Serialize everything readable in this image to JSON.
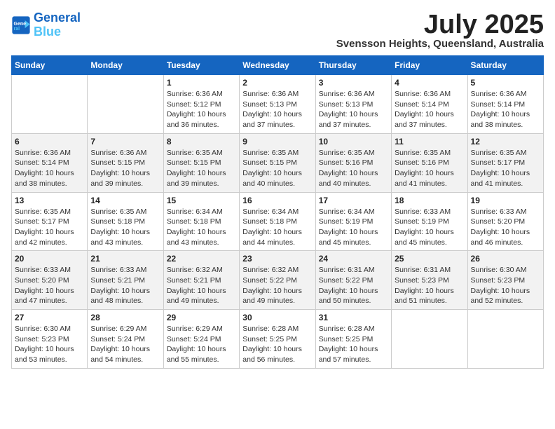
{
  "logo": {
    "line1": "General",
    "line2": "Blue"
  },
  "title": {
    "month_year": "July 2025",
    "location": "Svensson Heights, Queensland, Australia"
  },
  "weekdays": [
    "Sunday",
    "Monday",
    "Tuesday",
    "Wednesday",
    "Thursday",
    "Friday",
    "Saturday"
  ],
  "weeks": [
    [
      {
        "day": "",
        "info": ""
      },
      {
        "day": "",
        "info": ""
      },
      {
        "day": "1",
        "info": "Sunrise: 6:36 AM\nSunset: 5:12 PM\nDaylight: 10 hours and 36 minutes."
      },
      {
        "day": "2",
        "info": "Sunrise: 6:36 AM\nSunset: 5:13 PM\nDaylight: 10 hours and 37 minutes."
      },
      {
        "day": "3",
        "info": "Sunrise: 6:36 AM\nSunset: 5:13 PM\nDaylight: 10 hours and 37 minutes."
      },
      {
        "day": "4",
        "info": "Sunrise: 6:36 AM\nSunset: 5:14 PM\nDaylight: 10 hours and 37 minutes."
      },
      {
        "day": "5",
        "info": "Sunrise: 6:36 AM\nSunset: 5:14 PM\nDaylight: 10 hours and 38 minutes."
      }
    ],
    [
      {
        "day": "6",
        "info": "Sunrise: 6:36 AM\nSunset: 5:14 PM\nDaylight: 10 hours and 38 minutes."
      },
      {
        "day": "7",
        "info": "Sunrise: 6:36 AM\nSunset: 5:15 PM\nDaylight: 10 hours and 39 minutes."
      },
      {
        "day": "8",
        "info": "Sunrise: 6:35 AM\nSunset: 5:15 PM\nDaylight: 10 hours and 39 minutes."
      },
      {
        "day": "9",
        "info": "Sunrise: 6:35 AM\nSunset: 5:15 PM\nDaylight: 10 hours and 40 minutes."
      },
      {
        "day": "10",
        "info": "Sunrise: 6:35 AM\nSunset: 5:16 PM\nDaylight: 10 hours and 40 minutes."
      },
      {
        "day": "11",
        "info": "Sunrise: 6:35 AM\nSunset: 5:16 PM\nDaylight: 10 hours and 41 minutes."
      },
      {
        "day": "12",
        "info": "Sunrise: 6:35 AM\nSunset: 5:17 PM\nDaylight: 10 hours and 41 minutes."
      }
    ],
    [
      {
        "day": "13",
        "info": "Sunrise: 6:35 AM\nSunset: 5:17 PM\nDaylight: 10 hours and 42 minutes."
      },
      {
        "day": "14",
        "info": "Sunrise: 6:35 AM\nSunset: 5:18 PM\nDaylight: 10 hours and 43 minutes."
      },
      {
        "day": "15",
        "info": "Sunrise: 6:34 AM\nSunset: 5:18 PM\nDaylight: 10 hours and 43 minutes."
      },
      {
        "day": "16",
        "info": "Sunrise: 6:34 AM\nSunset: 5:18 PM\nDaylight: 10 hours and 44 minutes."
      },
      {
        "day": "17",
        "info": "Sunrise: 6:34 AM\nSunset: 5:19 PM\nDaylight: 10 hours and 45 minutes."
      },
      {
        "day": "18",
        "info": "Sunrise: 6:33 AM\nSunset: 5:19 PM\nDaylight: 10 hours and 45 minutes."
      },
      {
        "day": "19",
        "info": "Sunrise: 6:33 AM\nSunset: 5:20 PM\nDaylight: 10 hours and 46 minutes."
      }
    ],
    [
      {
        "day": "20",
        "info": "Sunrise: 6:33 AM\nSunset: 5:20 PM\nDaylight: 10 hours and 47 minutes."
      },
      {
        "day": "21",
        "info": "Sunrise: 6:33 AM\nSunset: 5:21 PM\nDaylight: 10 hours and 48 minutes."
      },
      {
        "day": "22",
        "info": "Sunrise: 6:32 AM\nSunset: 5:21 PM\nDaylight: 10 hours and 49 minutes."
      },
      {
        "day": "23",
        "info": "Sunrise: 6:32 AM\nSunset: 5:22 PM\nDaylight: 10 hours and 49 minutes."
      },
      {
        "day": "24",
        "info": "Sunrise: 6:31 AM\nSunset: 5:22 PM\nDaylight: 10 hours and 50 minutes."
      },
      {
        "day": "25",
        "info": "Sunrise: 6:31 AM\nSunset: 5:23 PM\nDaylight: 10 hours and 51 minutes."
      },
      {
        "day": "26",
        "info": "Sunrise: 6:30 AM\nSunset: 5:23 PM\nDaylight: 10 hours and 52 minutes."
      }
    ],
    [
      {
        "day": "27",
        "info": "Sunrise: 6:30 AM\nSunset: 5:23 PM\nDaylight: 10 hours and 53 minutes."
      },
      {
        "day": "28",
        "info": "Sunrise: 6:29 AM\nSunset: 5:24 PM\nDaylight: 10 hours and 54 minutes."
      },
      {
        "day": "29",
        "info": "Sunrise: 6:29 AM\nSunset: 5:24 PM\nDaylight: 10 hours and 55 minutes."
      },
      {
        "day": "30",
        "info": "Sunrise: 6:28 AM\nSunset: 5:25 PM\nDaylight: 10 hours and 56 minutes."
      },
      {
        "day": "31",
        "info": "Sunrise: 6:28 AM\nSunset: 5:25 PM\nDaylight: 10 hours and 57 minutes."
      },
      {
        "day": "",
        "info": ""
      },
      {
        "day": "",
        "info": ""
      }
    ]
  ]
}
